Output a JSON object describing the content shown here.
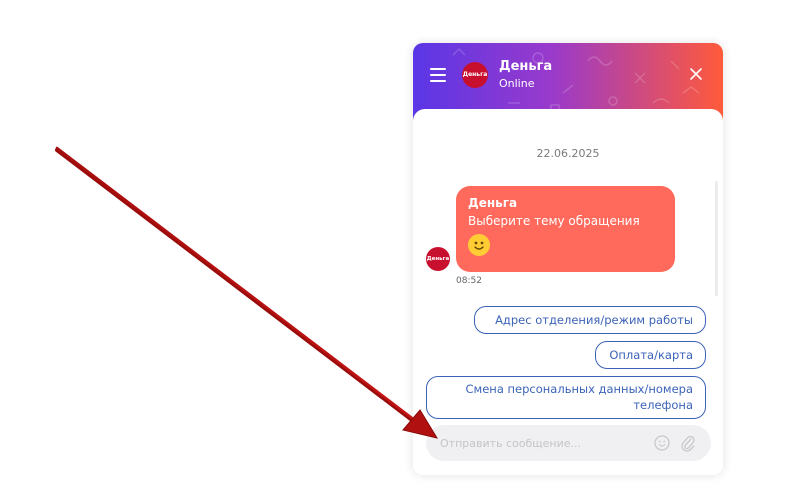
{
  "header": {
    "title": "Деньга",
    "status": "Online",
    "avatar_text": "Деньга",
    "gradient": [
      "#5a36e6",
      "#9a3acb",
      "#ff5a3a"
    ],
    "menu_icon": "hamburger-icon",
    "close_icon": "close-icon"
  },
  "chat": {
    "date": "22.06.2025",
    "message": {
      "sender": "Деньга",
      "text": "Выберите тему обращения",
      "emoji": "smiley-icon",
      "time": "08:52",
      "avatar_text": "Деньга",
      "bubble_color": "#ff6a5c"
    },
    "quick_replies": [
      "Адрес отделения/режим работы",
      "Оплата/карта",
      "Смена персональных данных/номера телефона"
    ]
  },
  "composer": {
    "placeholder": "Отправить сообщение...",
    "emoji_icon": "emoji-icon",
    "attach_icon": "paperclip-icon"
  },
  "annotation": {
    "arrow_color": "#b01010"
  }
}
